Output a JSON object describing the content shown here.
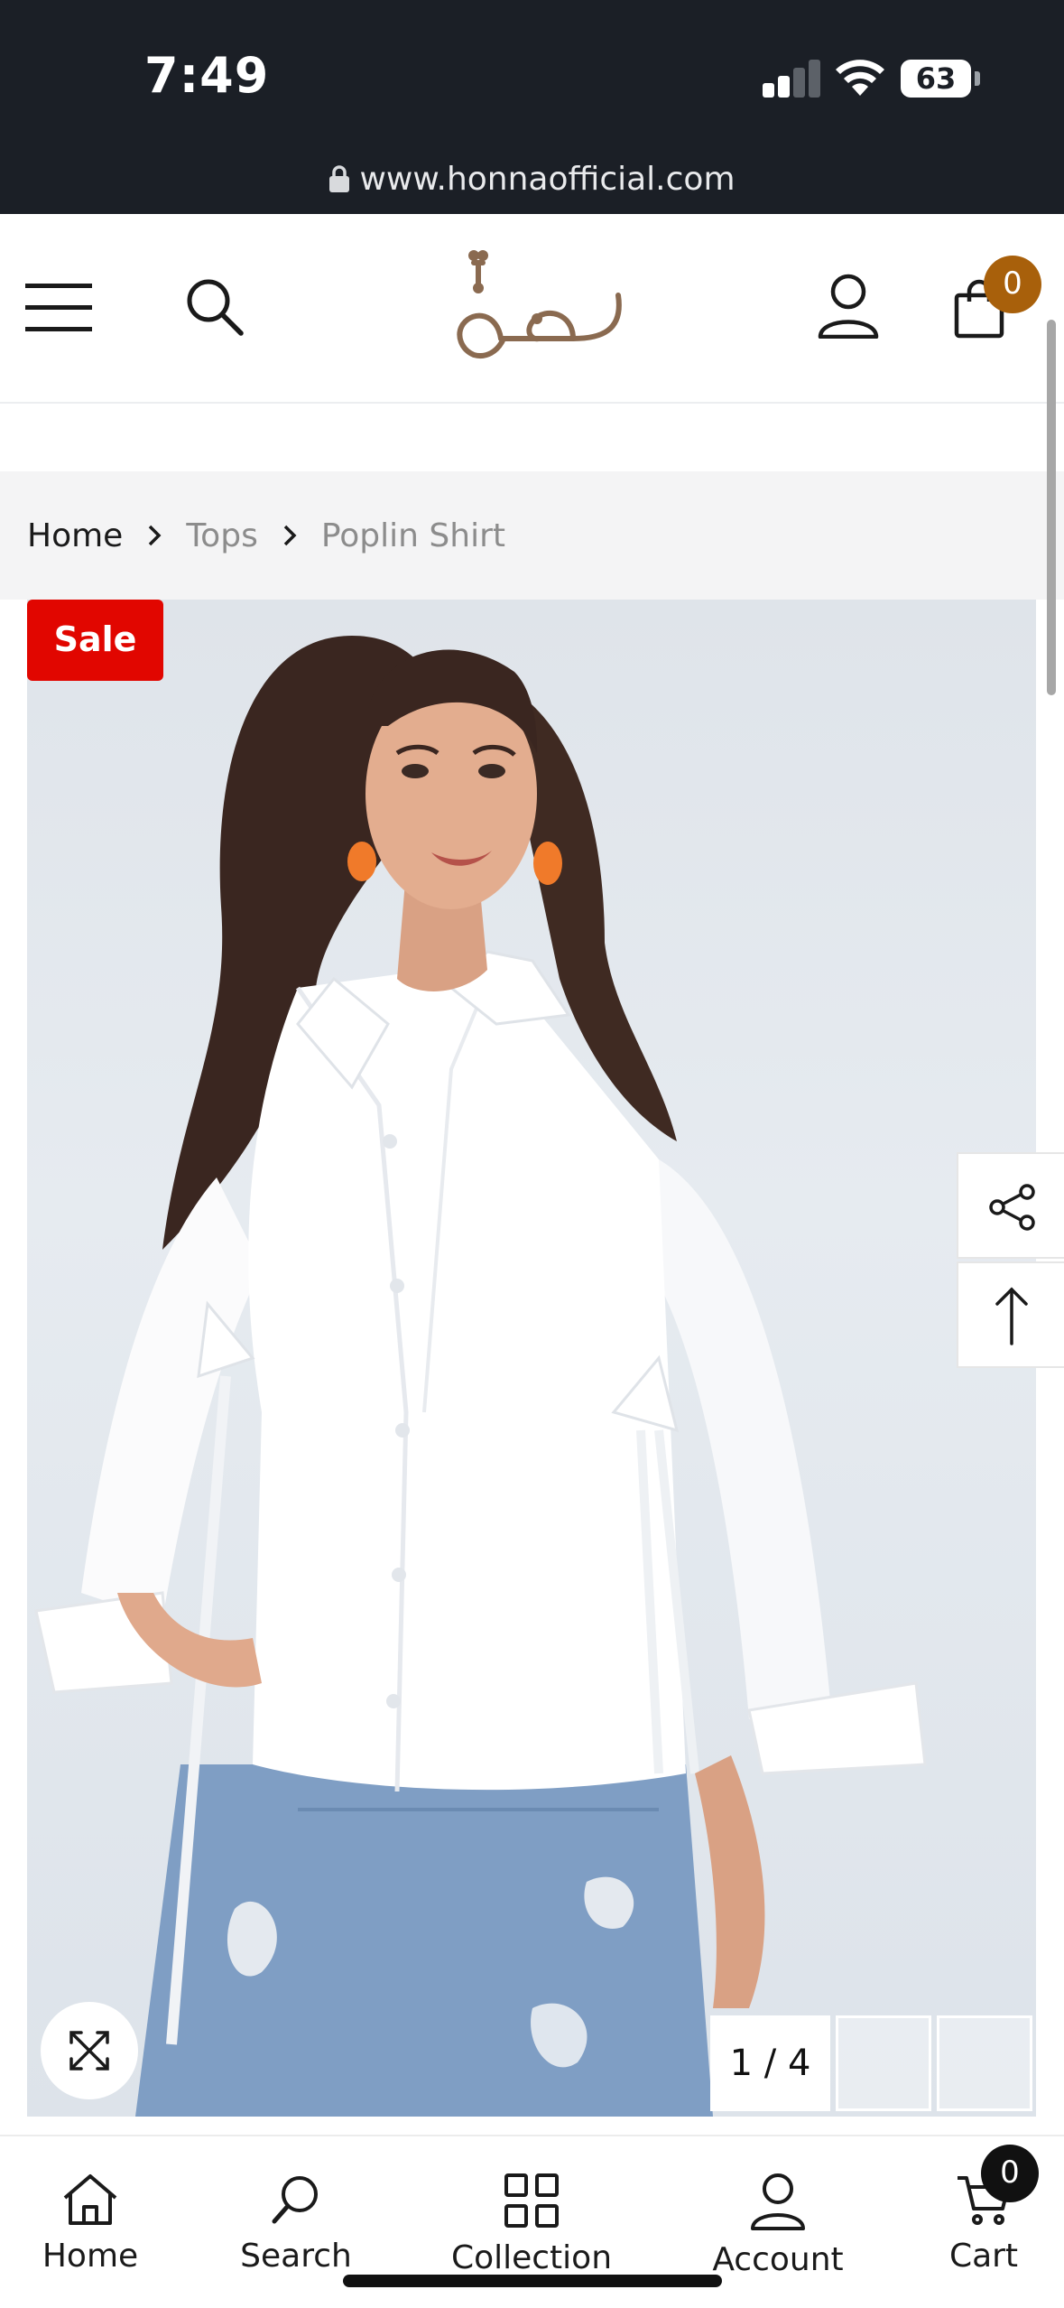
{
  "status_bar": {
    "time": "7:49",
    "battery": "63",
    "url": "www.honnaofficial.com"
  },
  "header": {
    "menu_icon": "hamburger-icon",
    "search_icon": "search-icon",
    "account_icon": "user-icon",
    "cart_icon": "shopping-bag-icon",
    "cart_count": "0",
    "brand_color": "#8a6a50",
    "badge_color": "#a8600b"
  },
  "breadcrumb": {
    "items": [
      "Home",
      "Tops",
      "Poplin Shirt"
    ]
  },
  "product": {
    "sale_badge": "Sale",
    "image_counter": "1 / 4",
    "sale_color": "#e10600"
  },
  "side_actions": {
    "share_icon": "share-icon",
    "top_icon": "arrow-up-icon"
  },
  "bottom_nav": {
    "items": [
      {
        "label": "Home",
        "icon": "home-icon"
      },
      {
        "label": "Search",
        "icon": "search-icon"
      },
      {
        "label": "Collection",
        "icon": "grid-icon"
      },
      {
        "label": "Account",
        "icon": "user-icon"
      },
      {
        "label": "Cart",
        "icon": "cart-icon"
      }
    ],
    "cart_count": "0"
  }
}
